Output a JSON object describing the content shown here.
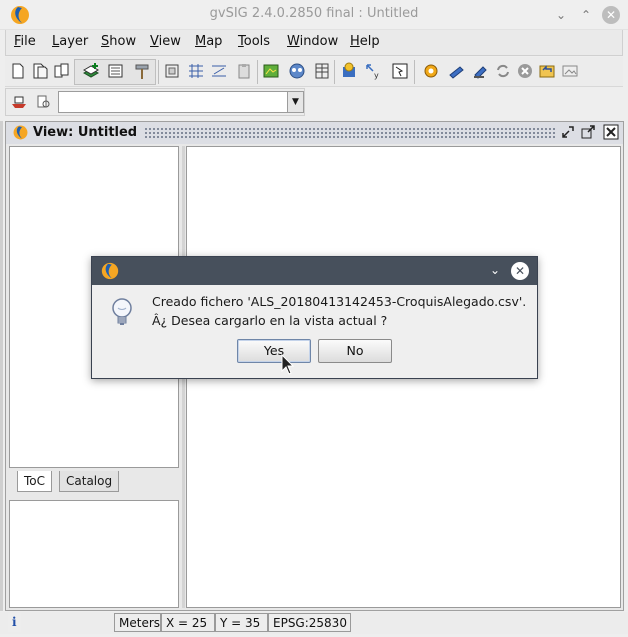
{
  "window": {
    "title": "gvSIG 2.4.0.2850 final : Untitled",
    "minimize_glyph": "⌄",
    "maximize_glyph": "⌃",
    "close_glyph": "✕"
  },
  "menubar": {
    "items": [
      "File",
      "Layer",
      "Show",
      "View",
      "Map",
      "Tools",
      "Window",
      "Help"
    ]
  },
  "toolbar": {
    "icons": [
      "new-document-icon",
      "open-document-icon",
      "save-document-icon",
      "add-layer-icon",
      "layer-list-icon",
      "hammer-icon",
      "rectangle-select-icon",
      "grid-icon",
      "axis-icon",
      "clipboard-icon",
      "raster-icon",
      "globe-icon",
      "table-icon",
      "gear-blue-icon",
      "measure-icon",
      "select-info-icon",
      "settings-gear-icon",
      "edit-icon",
      "edit2-icon",
      "sync-icon",
      "cancel-icon",
      "undo-icon",
      "image-icon"
    ],
    "combo_value": ""
  },
  "view": {
    "title": "View: Untitled",
    "tabs": [
      {
        "label": "ToC",
        "active": true
      },
      {
        "label": "Catalog",
        "active": false
      }
    ]
  },
  "dialog": {
    "message_line1": "Creado fichero 'ALS_20180413142453-CroquisAlegado.csv'.",
    "message_line2": "Â¿ Desea cargarlo en la vista actual ?",
    "yes_label": "Yes",
    "no_label": "No",
    "minimize_glyph": "⌄",
    "close_glyph": "✕"
  },
  "statusbar": {
    "info": "i",
    "units": "Meters",
    "x": "X = 25",
    "y": "Y = 35",
    "epsg": "EPSG:25830"
  }
}
